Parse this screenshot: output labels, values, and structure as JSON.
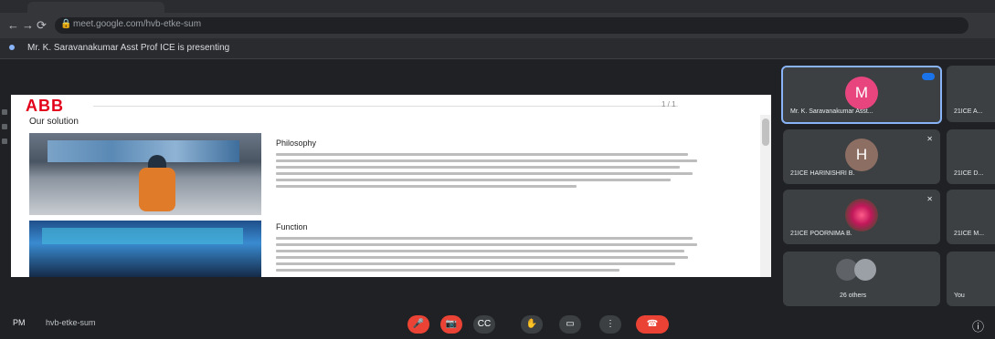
{
  "browser": {
    "url": "meet.google.com/hvb-etke-sum",
    "nav": {
      "back": "←",
      "forward": "→",
      "reload": "⟳"
    }
  },
  "banner": {
    "presenting_text": "Mr. K. Saravanakumar Asst Prof ICE is presenting"
  },
  "slide": {
    "logo": "ABB",
    "title": "Our solution",
    "page_indicator": "1 / 1",
    "sections": [
      {
        "heading": "Philosophy"
      },
      {
        "heading": "Function"
      }
    ]
  },
  "participants": [
    {
      "name": "Mr. K. Saravanakumar Asst...",
      "avatar_letter": "M",
      "avatar_color": "#e8457f",
      "speaking": true
    },
    {
      "name": "21ICE A...",
      "avatar_letter": "",
      "avatar_color": "#3c4043"
    },
    {
      "name": "21ICE HARINISHRI B.",
      "avatar_letter": "H",
      "avatar_color": "#8d6e63",
      "muted": true
    },
    {
      "name": "21ICE D...",
      "avatar_letter": "",
      "avatar_color": "#3c4043"
    },
    {
      "name": "21ICE POORNIMA B.",
      "avatar_letter": "",
      "avatar_color": "#c2185b",
      "muted": true
    },
    {
      "name": "21ICE M...",
      "avatar_letter": "",
      "avatar_color": "#3c4043"
    },
    {
      "name": "26 others",
      "avatar_letter": "",
      "avatar_color": "#5f6368"
    },
    {
      "name": "You",
      "avatar_letter": "",
      "avatar_color": "#3c4043"
    }
  ],
  "bottom_bar": {
    "time": "PM",
    "meeting_code": "hvb-etke-sum",
    "buttons": {
      "mic": "🎤",
      "camera": "📷",
      "captions": "CC",
      "raise_hand": "✋",
      "present": "▭",
      "more": "⋮",
      "end_call": "☎"
    },
    "info": "ⓘ"
  }
}
